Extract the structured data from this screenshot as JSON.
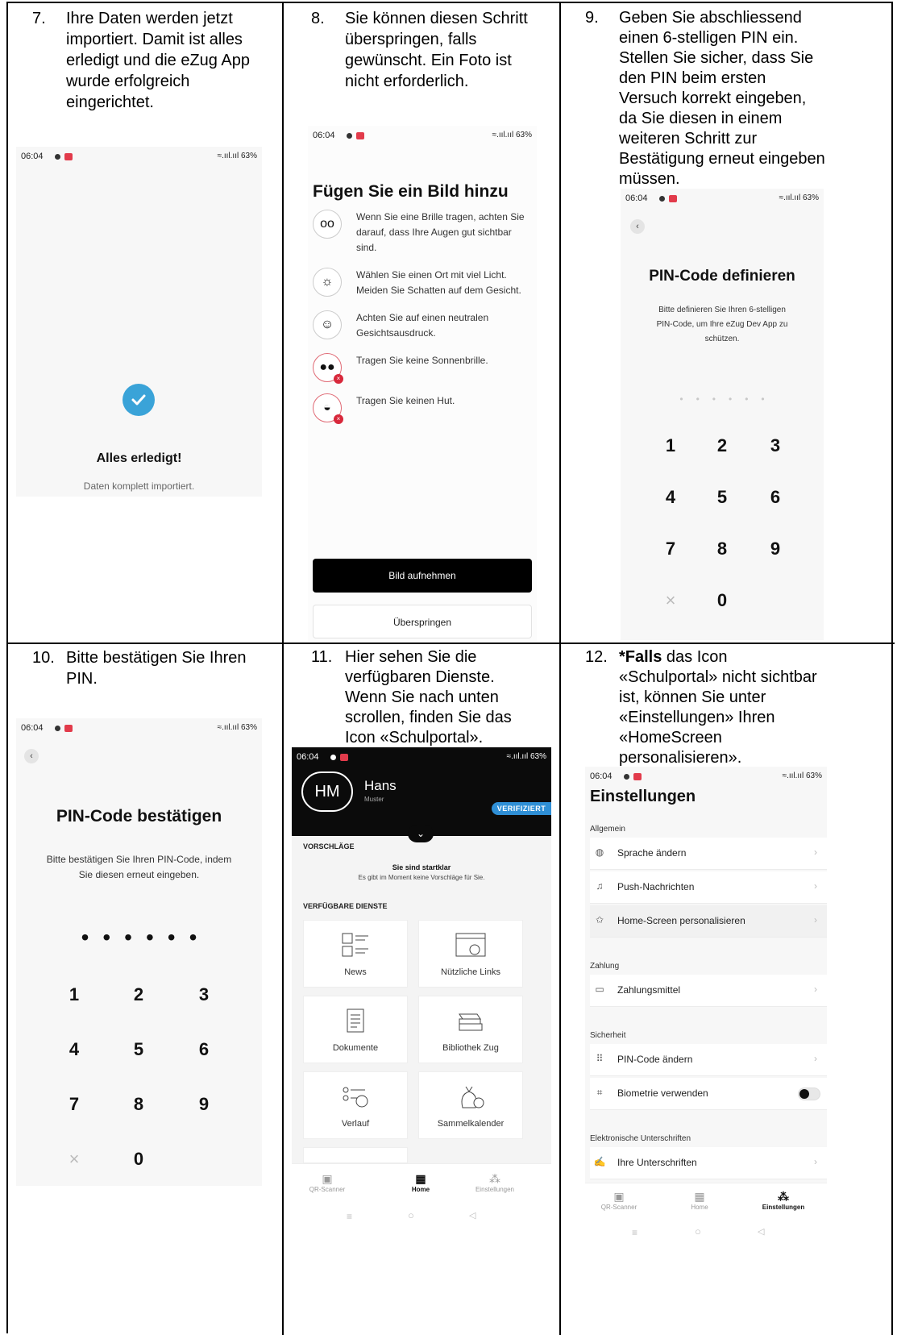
{
  "cells": [
    {
      "num": "7.",
      "lines": [
        "Ihre Daten werden jetzt",
        "importiert. Damit ist alles",
        "erledigt und die eZug App",
        "wurde erfolgreich",
        "eingerichtet."
      ]
    },
    {
      "num": "8.",
      "lines": [
        "Sie können diesen Schritt",
        "überspringen, falls",
        "gewünscht. Ein Foto ist",
        "nicht erforderlich."
      ]
    },
    {
      "num": "9.",
      "lines": [
        "Geben Sie abschliessend",
        "einen 6-stelligen PIN ein.",
        "Stellen Sie sicher, dass Sie",
        "den PIN beim ersten",
        "Versuch korrekt eingeben,",
        "da Sie diesen in einem",
        "weiteren Schritt zur",
        "Bestätigung erneut eingeben",
        "müssen."
      ]
    },
    {
      "num": "10.",
      "lines": [
        "Bitte bestätigen Sie Ihren",
        "PIN."
      ]
    },
    {
      "num": "11.",
      "lines": [
        "Hier sehen Sie die",
        "verfügbaren Dienste.",
        "Wenn Sie nach unten",
        "scrollen, finden Sie das",
        "Icon «Schulportal»."
      ]
    },
    {
      "num": "12.",
      "bold": "*Falls",
      "first_rest": " das Icon",
      "lines": [
        "«Schulportal» nicht sichtbar",
        "ist, können Sie unter",
        "«Einstellungen» Ihren",
        "«HomeScreen",
        "personalisieren»."
      ]
    }
  ],
  "status": {
    "time": "06:04",
    "signal": "≈.ııl.ııl 63%"
  },
  "screen7": {
    "title": "Alles erledigt!",
    "subtitle": "Daten komplett importiert."
  },
  "screen8": {
    "title": "Fügen Sie ein Bild hinzu",
    "tips": [
      {
        "icon": "glasses-icon",
        "lines": [
          "Wenn Sie eine Brille tragen, achten Sie",
          "darauf, dass Ihre Augen gut sichtbar",
          "sind."
        ]
      },
      {
        "icon": "sun-icon",
        "lines": [
          "Wählen Sie einen Ort mit viel Licht.",
          "Meiden Sie Schatten auf dem Gesicht."
        ]
      },
      {
        "icon": "smiley-icon",
        "lines": [
          "Achten Sie auf einen neutralen",
          "Gesichtsausdruck."
        ]
      },
      {
        "icon": "sunglasses-icon",
        "lines": [
          "Tragen Sie keine Sonnenbrille."
        ]
      },
      {
        "icon": "hat-icon",
        "lines": [
          "Tragen Sie keinen Hut."
        ]
      }
    ],
    "primary_button": "Bild aufnehmen",
    "secondary_button": "Überspringen"
  },
  "screen9": {
    "title": "PIN-Code definieren",
    "desc": [
      "Bitte definieren Sie Ihren 6-stelligen",
      "PIN-Code, um Ihre eZug Dev App zu",
      "schützen."
    ],
    "keys": [
      "1",
      "2",
      "3",
      "4",
      "5",
      "6",
      "7",
      "8",
      "9",
      "×",
      "0"
    ]
  },
  "screen10": {
    "title": "PIN-Code bestätigen",
    "desc": [
      "Bitte bestätigen Sie Ihren PIN-Code, indem",
      "Sie diesen erneut eingeben."
    ],
    "keys": [
      "1",
      "2",
      "3",
      "4",
      "5",
      "6",
      "7",
      "8",
      "9",
      "×",
      "0"
    ]
  },
  "screen11": {
    "initials": "HM",
    "first_name": "Hans",
    "last_name": "Muster",
    "badge": "VERIFIZIERT",
    "suggestions_header": "VORSCHLÄGE",
    "ready_title": "Sie sind startklar",
    "ready_desc": "Es gibt im Moment keine Vorschläge für Sie.",
    "services_header": "VERFÜGBARE DIENSTE",
    "services": [
      "News",
      "Nützliche Links",
      "Dokumente",
      "Bibliothek Zug",
      "Verlauf",
      "Sammelkalender"
    ],
    "tabs": [
      "QR-Scanner",
      "Home",
      "Einstellungen"
    ]
  },
  "screen12": {
    "title": "Einstellungen",
    "sections": {
      "general": "Allgemein",
      "payment": "Zahlung",
      "security": "Sicherheit",
      "signatures": "Elektronische Unterschriften"
    },
    "rows": {
      "language": "Sprache ändern",
      "push": "Push-Nachrichten",
      "home": "Home-Screen personalisieren",
      "payment": "Zahlungsmittel",
      "pin": "PIN-Code ändern",
      "bio": "Biometrie verwenden",
      "sign": "Ihre Unterschriften"
    },
    "tabs": [
      "QR-Scanner",
      "Home",
      "Einstellungen"
    ]
  },
  "nav": {
    "menu": "≡",
    "home": "○",
    "back": "◁"
  },
  "colors": {
    "accent_check": "#3aa3d8",
    "badge": "#2f8fd6",
    "danger": "#d8283b"
  }
}
